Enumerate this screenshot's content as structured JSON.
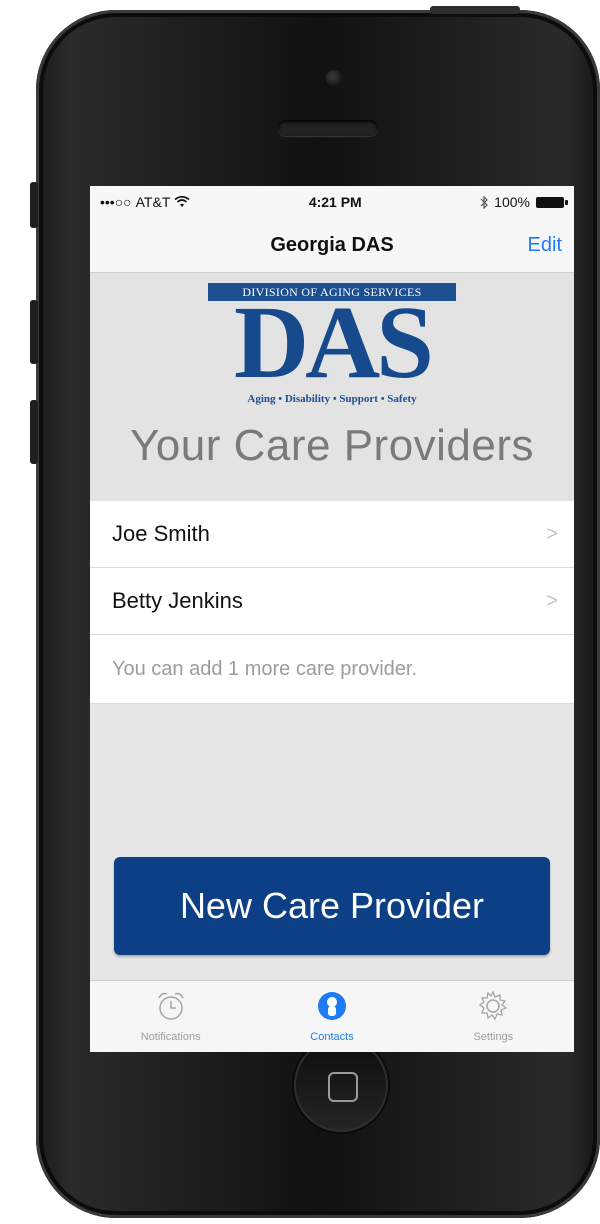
{
  "status_bar": {
    "signal": "•••○○",
    "carrier": "AT&T",
    "time": "4:21 PM",
    "battery": "100%",
    "icons": [
      "wifi-icon",
      "bluetooth-icon",
      "battery-icon"
    ]
  },
  "nav": {
    "title": "Georgia DAS",
    "edit_label": "Edit"
  },
  "logo": {
    "banner": "DIVISION OF AGING SERVICES",
    "text": "DAS",
    "tagline": "Aging • Disability • Support • Safety"
  },
  "heading": "Your Care Providers",
  "providers": [
    {
      "name": "Joe Smith"
    },
    {
      "name": "Betty Jenkins"
    }
  ],
  "footer_note": "You can add 1 more care provider.",
  "cta_label": "New Care Provider",
  "tabs": [
    {
      "label": "Notifications",
      "icon": "alarm-clock-icon",
      "active": false
    },
    {
      "label": "Contacts",
      "icon": "contact-icon",
      "active": true
    },
    {
      "label": "Settings",
      "icon": "gear-icon",
      "active": false
    }
  ],
  "colors": {
    "accent": "#1e7bf5",
    "brand": "#0d3f86"
  }
}
